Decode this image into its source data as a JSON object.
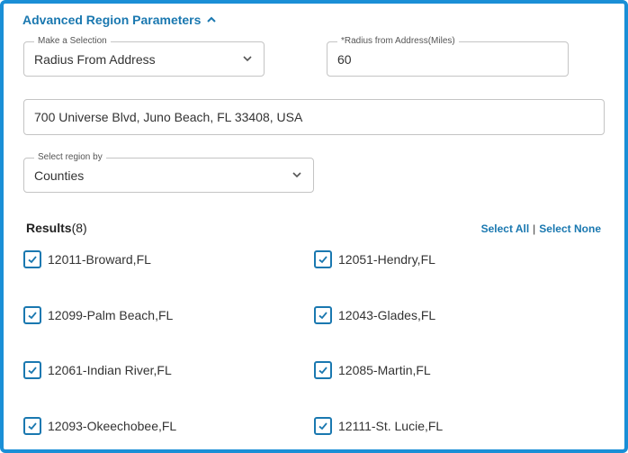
{
  "panel": {
    "title": "Advanced Region Parameters",
    "collapse_icon": "chevron-up-icon",
    "accent_color": "#1a78b0",
    "border_color": "#1a8fd6"
  },
  "selection": {
    "label": "Make a Selection",
    "value": "Radius From Address",
    "icon": "chevron-down-icon"
  },
  "radius": {
    "label": "*Radius from Address(Miles)",
    "value": "60"
  },
  "address": {
    "value": "700 Universe Blvd, Juno Beach, FL 33408, USA"
  },
  "region_by": {
    "label": "Select region by",
    "value": "Counties",
    "icon": "chevron-down-icon"
  },
  "results": {
    "label": "Results",
    "count": "(8)",
    "select_all": "Select All",
    "separator": "|",
    "select_none": "Select None",
    "items": [
      {
        "label": "12011-Broward,FL",
        "checked": true
      },
      {
        "label": "12051-Hendry,FL",
        "checked": true
      },
      {
        "label": "12099-Palm Beach,FL",
        "checked": true
      },
      {
        "label": "12043-Glades,FL",
        "checked": true
      },
      {
        "label": "12061-Indian River,FL",
        "checked": true
      },
      {
        "label": "12085-Martin,FL",
        "checked": true
      },
      {
        "label": "12093-Okeechobee,FL",
        "checked": true
      },
      {
        "label": "12111-St. Lucie,FL",
        "checked": true
      }
    ]
  }
}
